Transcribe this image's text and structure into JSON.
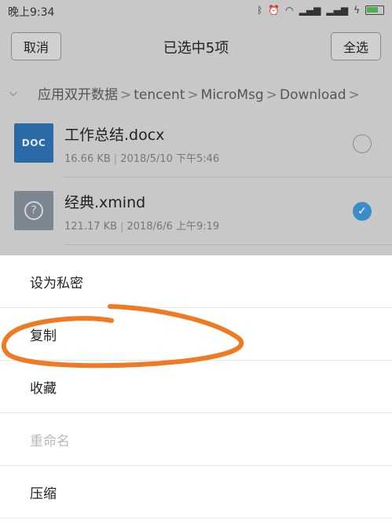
{
  "status_bar": {
    "time": "晚上9:34",
    "icons": [
      "bluetooth-icon",
      "alarm-icon",
      "wifi-icon",
      "signal-icon",
      "signal-icon",
      "charging-icon",
      "battery-icon"
    ]
  },
  "header": {
    "cancel_label": "取消",
    "title": "已选中5项",
    "select_all_label": "全选"
  },
  "breadcrumb": {
    "segments": [
      "应用双开数据",
      "tencent",
      "MicroMsg",
      "Download"
    ],
    "separator": ">"
  },
  "files": [
    {
      "icon_label": "DOC",
      "name": "工作总结.docx",
      "size": "16.66 KB",
      "date": "2018/5/10 下午5:46",
      "selected": false
    },
    {
      "icon_label": "?",
      "name": "经典.xmind",
      "size": "121.17 KB",
      "date": "2018/6/6 上午9:19",
      "selected": true
    }
  ],
  "menu": {
    "items": [
      {
        "label": "设为私密",
        "enabled": true
      },
      {
        "label": "复制",
        "enabled": true
      },
      {
        "label": "收藏",
        "enabled": true
      },
      {
        "label": "重命名",
        "enabled": false
      },
      {
        "label": "压缩",
        "enabled": true
      }
    ]
  },
  "colors": {
    "accent": "#3a8ec6",
    "doc_icon": "#2b6aa6",
    "annotation": "#f07a24",
    "battery": "#4caf50"
  }
}
